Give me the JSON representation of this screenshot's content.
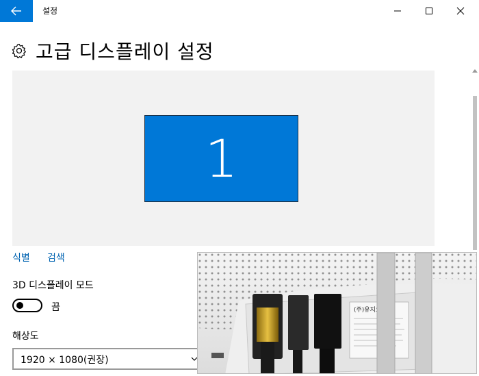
{
  "window": {
    "app_title": "설정",
    "back_icon": "back-arrow-icon",
    "controls": [
      "minimize-icon",
      "maximize-icon",
      "close-icon"
    ],
    "accent_color": "#0078d7"
  },
  "header": {
    "icon": "gear-icon",
    "title": "고급 디스플레이 설정"
  },
  "preview": {
    "monitor_number": "1",
    "monitor_color": "#0078d7"
  },
  "links": {
    "identify": "식별",
    "detect": "검색"
  },
  "display_3d": {
    "label": "3D 디스플레이 모드",
    "toggle_state": "끔",
    "enabled": false
  },
  "resolution": {
    "label": "해상도",
    "selected": "1920 × 1080(권장)"
  },
  "photo_overlay": {
    "label_text": "(주)유지코리"
  }
}
